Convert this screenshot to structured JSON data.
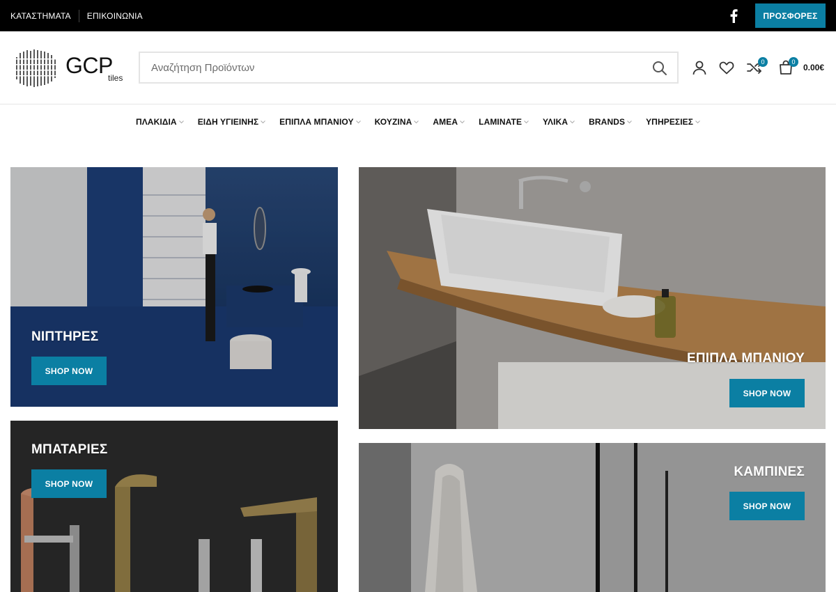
{
  "topbar": {
    "links": [
      "ΚΑΤΑΣΤΗΜΑΤΑ",
      "ΕΠΙΚΟΙΝΩΝΙΑ"
    ],
    "promo_label": "ΠΡΟΣΦΟΡΕΣ",
    "social_icon": "facebook-icon"
  },
  "header": {
    "logo_text": "GCP",
    "logo_sub": "tiles",
    "search_placeholder": "Αναζήτηση Προϊόντων",
    "compare_count": "0",
    "cart_count": "0",
    "cart_total": "0.00€"
  },
  "nav": {
    "items": [
      "ΠΛΑΚΙΔΙΑ",
      "ΕΙΔΗ ΥΓΙΕΙΝΗΣ",
      "ΕΠΙΠΛΑ ΜΠΑΝΙΟΥ",
      "ΚΟΥΖΙΝΑ",
      "ΑΜΕΑ",
      "LAMINATE",
      "ΥΛΙΚΑ",
      "BRANDS",
      "ΥΠΗΡΕΣΙΕΣ"
    ]
  },
  "banners": [
    {
      "title": "ΝΙΠΤΗΡΕΣ",
      "button": "SHOP NOW"
    },
    {
      "title": "ΕΠΙΠΛΑ ΜΠΑΝΙΟΥ",
      "button": "SHOP NOW"
    },
    {
      "title": "ΜΠΑΤΑΡΙΕΣ",
      "button": "SHOP NOW"
    },
    {
      "title": "ΚΑΜΠΙΝΕΣ",
      "button": "SHOP NOW"
    }
  ],
  "colors": {
    "accent": "#0b7fa3",
    "topbar_bg": "#000000"
  }
}
